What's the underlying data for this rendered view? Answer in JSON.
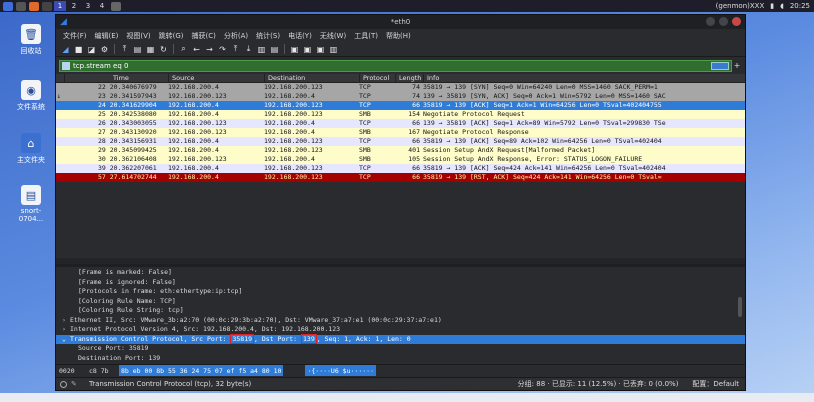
{
  "topbar": {
    "workspaces": [
      "1",
      "2",
      "3",
      "4"
    ],
    "user": "(genmon)XXX",
    "time": "20:25"
  },
  "desktop_icons": [
    {
      "label": "回收站",
      "icon": "trash-icon"
    },
    {
      "label": "文件系统",
      "icon": "disk-icon"
    },
    {
      "label": "主文件夹",
      "icon": "home-folder-icon"
    },
    {
      "label": "snort-0704...",
      "icon": "document-icon"
    }
  ],
  "window": {
    "title": "*eth0",
    "menu": [
      "文件(F)",
      "编辑(E)",
      "视图(V)",
      "跳转(G)",
      "捕获(C)",
      "分析(A)",
      "统计(S)",
      "电话(Y)",
      "无线(W)",
      "工具(T)",
      "帮助(H)"
    ],
    "filter": "tcp.stream eq 0"
  },
  "packet_list": {
    "columns": [
      "",
      "Time",
      "Source",
      "Destination",
      "Protocol",
      "Length",
      "Info"
    ],
    "rows": [
      {
        "mark": "",
        "no_time": "22 20.340676979",
        "src": "192.168.200.4",
        "dst": "192.168.200.123",
        "proto": "TCP",
        "len": "74",
        "info": "35819 → 139 [SYN] Seq=0 Win=64240 Len=0 MSS=1460 SACK_PERM=1",
        "style": "r-grey"
      },
      {
        "mark": "↓",
        "no_time": "23 20.341597943",
        "src": "192.168.200.123",
        "dst": "192.168.200.4",
        "proto": "TCP",
        "len": "74",
        "info": "139 → 35819 [SYN, ACK] Seq=0 Ack=1 Win=5792 Len=0 MSS=1460 SAC",
        "style": "r-grey"
      },
      {
        "mark": "",
        "no_time": "24 20.341629904",
        "src": "192.168.200.4",
        "dst": "192.168.200.123",
        "proto": "TCP",
        "len": "66",
        "info": "35819 → 139 [ACK] Seq=1 Ack=1 Win=64256 Len=0 TSval=402404755",
        "style": "r-sel"
      },
      {
        "mark": "",
        "no_time": "25 20.342538080",
        "src": "192.168.200.4",
        "dst": "192.168.200.123",
        "proto": "SMB",
        "len": "154",
        "info": "Negotiate Protocol Request",
        "style": "r-smb"
      },
      {
        "mark": "",
        "no_time": "26 20.343003055",
        "src": "192.168.200.123",
        "dst": "192.168.200.4",
        "proto": "TCP",
        "len": "66",
        "info": "139 → 35819 [ACK] Seq=1 Ack=89 Win=5792 Len=0 TSval=299830 TSe",
        "style": "r-ack"
      },
      {
        "mark": "",
        "no_time": "27 20.343130920",
        "src": "192.168.200.123",
        "dst": "192.168.200.4",
        "proto": "SMB",
        "len": "167",
        "info": "Negotiate Protocol Response",
        "style": "r-smb"
      },
      {
        "mark": "",
        "no_time": "28 20.343156931",
        "src": "192.168.200.4",
        "dst": "192.168.200.123",
        "proto": "TCP",
        "len": "66",
        "info": "35819 → 139 [ACK] Seq=89 Ack=102 Win=64256 Len=0 TSval=402404",
        "style": "r-ack"
      },
      {
        "mark": "",
        "no_time": "29 20.345099425",
        "src": "192.168.200.4",
        "dst": "192.168.200.123",
        "proto": "SMB",
        "len": "401",
        "info": "Session Setup AndX Request[Malformed Packet]",
        "style": "r-smb"
      },
      {
        "mark": "",
        "no_time": "30 20.362106408",
        "src": "192.168.200.123",
        "dst": "192.168.200.4",
        "proto": "SMB",
        "len": "105",
        "info": "Session Setup AndX Response, Error: STATUS_LOGON_FAILURE",
        "style": "r-smb"
      },
      {
        "mark": "",
        "no_time": "39 20.362207061",
        "src": "192.168.200.4",
        "dst": "192.168.200.123",
        "proto": "TCP",
        "len": "66",
        "info": "35819 → 139 [ACK] Seq=424 Ack=141 Win=64256 Len=0 TSval=402404",
        "style": "r-ack"
      },
      {
        "mark": "",
        "no_time": "57 27.614702744",
        "src": "192.168.200.4",
        "dst": "192.168.200.123",
        "proto": "TCP",
        "len": "66",
        "info": "35819 → 139 [RST, ACK] Seq=424 Ack=141 Win=64256 Len=0 TSval=",
        "style": "r-rst"
      }
    ]
  },
  "details": {
    "frame_marked": "[Frame is marked: False]",
    "frame_ignored": "[Frame is ignored: False]",
    "protocols": "[Protocols in frame: eth:ethertype:ip:tcp]",
    "coloring_rule": "[Coloring Rule Name: TCP]",
    "coloring_string": "[Coloring Rule String: tcp]",
    "ethernet": "Ethernet II, Src: VMware_3b:a2:70 (00:0c:29:3b:a2:70), Dst: VMware_37:a7:e1 (00:0c:29:37:a7:e1)",
    "ip": "Internet Protocol Version 4, Src: 192.168.200.4, Dst: 192.168.200.123",
    "tcp_prefix": "Transmission Control Protocol, Src Port: ",
    "tcp_src": "35819",
    "tcp_mid": ", Dst Port: ",
    "tcp_dst": "139",
    "tcp_suffix": ", Seq: 1, Ack: 1, Len: 0",
    "source_port": "Source Port: 35819",
    "dest_port": "Destination Port: 139"
  },
  "hex": {
    "offset": "0020",
    "pre": "c8 7b",
    "bytes": "8b eb 00 8b 55 36  24 75 07 ef f5 a4 80 10",
    "ascii": "·{····U6 $u······"
  },
  "status": {
    "field": "Transmission Control Protocol (tcp), 32 byte(s)",
    "packets": "分组: 88 · 已显示: 11 (12.5%) · 已丢弃: 0 (0.0%)",
    "profile": "配置：Default"
  }
}
